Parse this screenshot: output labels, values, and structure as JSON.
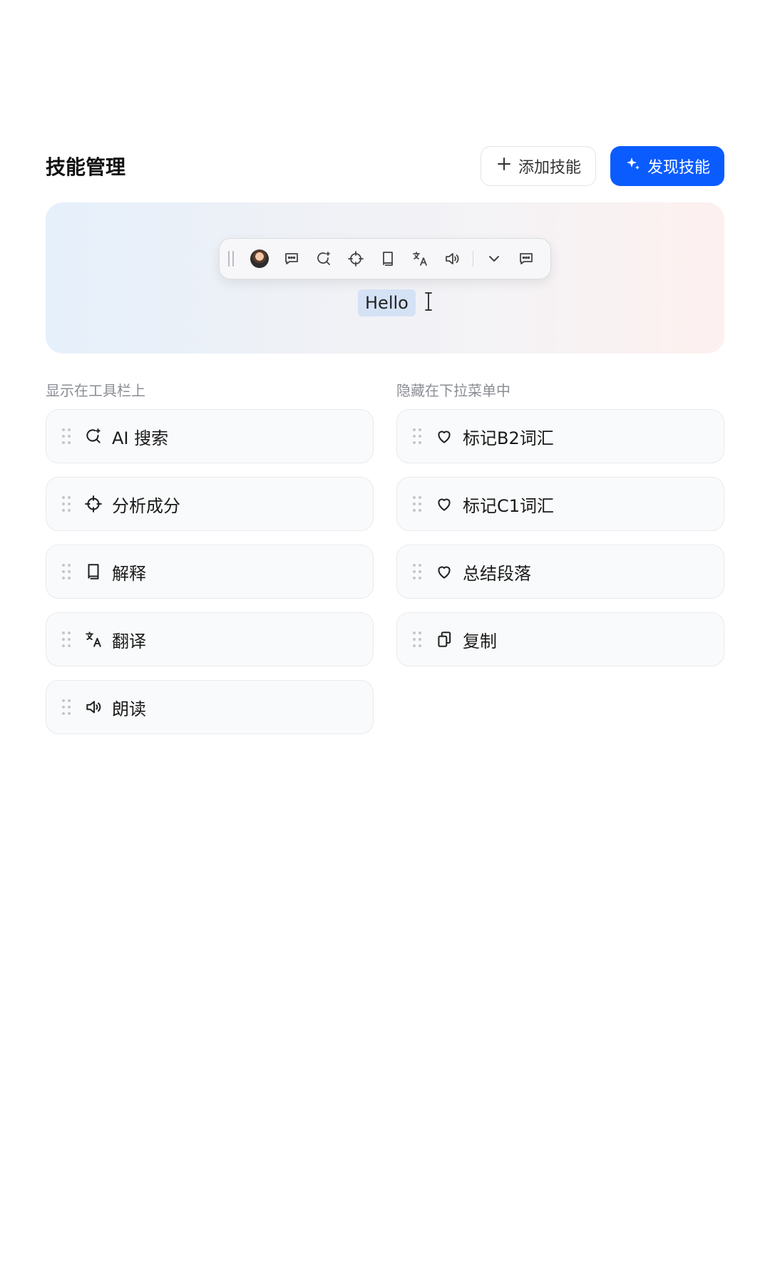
{
  "header": {
    "title": "技能管理",
    "add_label": "添加技能",
    "discover_label": "发现技能"
  },
  "colors": {
    "primary": "#0a5cff",
    "selection": "#d5e2f6"
  },
  "preview": {
    "toolbar_icons": [
      "avatar",
      "comment-icon",
      "ai-search-icon",
      "crosshair-icon",
      "book-icon",
      "translate-icon",
      "speaker-icon",
      "chevron-down-icon",
      "comment-icon"
    ],
    "sample_text": "Hello"
  },
  "visible_section": {
    "label": "显示在工具栏上",
    "items": [
      {
        "label": "AI 搜索",
        "icon": "ai-search-icon"
      },
      {
        "label": "分析成分",
        "icon": "crosshair-icon"
      },
      {
        "label": "解释",
        "icon": "book-icon"
      },
      {
        "label": "翻译",
        "icon": "translate-icon"
      },
      {
        "label": "朗读",
        "icon": "speaker-icon"
      }
    ]
  },
  "hidden_section": {
    "label": "隐藏在下拉菜单中",
    "items": [
      {
        "label": "标记B2词汇",
        "icon": "heart-icon"
      },
      {
        "label": "标记C1词汇",
        "icon": "heart-icon"
      },
      {
        "label": "总结段落",
        "icon": "heart-icon"
      },
      {
        "label": "复制",
        "icon": "copy-icon"
      }
    ]
  }
}
